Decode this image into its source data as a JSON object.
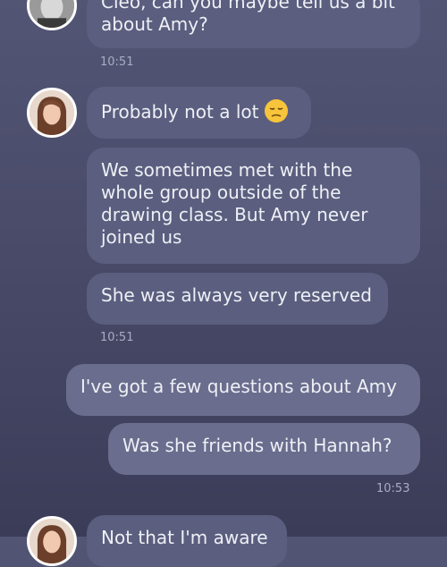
{
  "messages": [
    {
      "text": "Cleo, can you maybe tell us a bit\nabout Amy?"
    },
    {
      "text": "Probably not a lot",
      "emoji": "pensive-face-icon"
    },
    {
      "text": "We sometimes met with the\nwhole group outside of the\ndrawing class. But Amy never\njoined us"
    },
    {
      "text": "She was always very reserved"
    },
    {
      "text": "I've got a few questions about Amy"
    },
    {
      "text": "Was she friends with Hannah?"
    },
    {
      "text": "Not that I'm aware"
    }
  ],
  "timestamps": [
    "10:51",
    "10:51",
    "10:53"
  ],
  "colors": {
    "background": "#4a4c6a",
    "incoming_bubble": "#5b5e7e",
    "outgoing_bubble": "#6a6d8d",
    "text": "#eef0f6",
    "timestamp": "#a9acc2"
  }
}
